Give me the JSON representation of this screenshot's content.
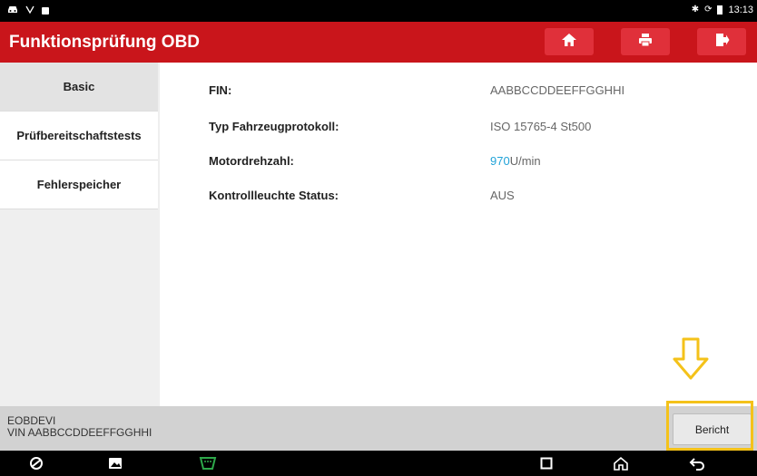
{
  "status_bar": {
    "time": "13:13",
    "left_icons": [
      "car-icon",
      "signal-icon",
      "square-icon"
    ],
    "right_icons": [
      "bluetooth-icon",
      "sync-icon",
      "battery-icon"
    ]
  },
  "header": {
    "title": "Funktionsprüfung OBD",
    "buttons": [
      {
        "name": "home-button",
        "icon": "home-icon"
      },
      {
        "name": "print-button",
        "icon": "printer-icon"
      },
      {
        "name": "exit-button",
        "icon": "exit-icon"
      }
    ],
    "colors": {
      "bar": "#c9151b",
      "button": "#e0303a"
    }
  },
  "sidebar": {
    "items": [
      {
        "label": "Basic",
        "active": true
      },
      {
        "label": "Prüfbereitschaftstests",
        "active": false
      },
      {
        "label": "Fehlerspeicher",
        "active": false
      }
    ]
  },
  "info": {
    "rows": [
      {
        "label": "FIN:",
        "value": "AABBCCDDEEFFGGHHI"
      },
      {
        "label": "Typ Fahrzeugprotokoll:",
        "value": "ISO 15765-4 St500"
      },
      {
        "label": "Motordrehzahl:",
        "value_number": "970",
        "value_unit": "U/min"
      },
      {
        "label": "Kontrollleuchte Status:",
        "value": "AUS"
      }
    ]
  },
  "footer": {
    "line1": "EOBDEVI",
    "line2": "VIN AABBCCDDEEFFGGHHI",
    "report_button": "Bericht",
    "highlight_color": "#f4c21a"
  },
  "nav_bar": {
    "icons": [
      "browser-icon",
      "gallery-icon",
      "obd-icon",
      "recents-icon",
      "home-nav-icon",
      "back-icon"
    ]
  }
}
